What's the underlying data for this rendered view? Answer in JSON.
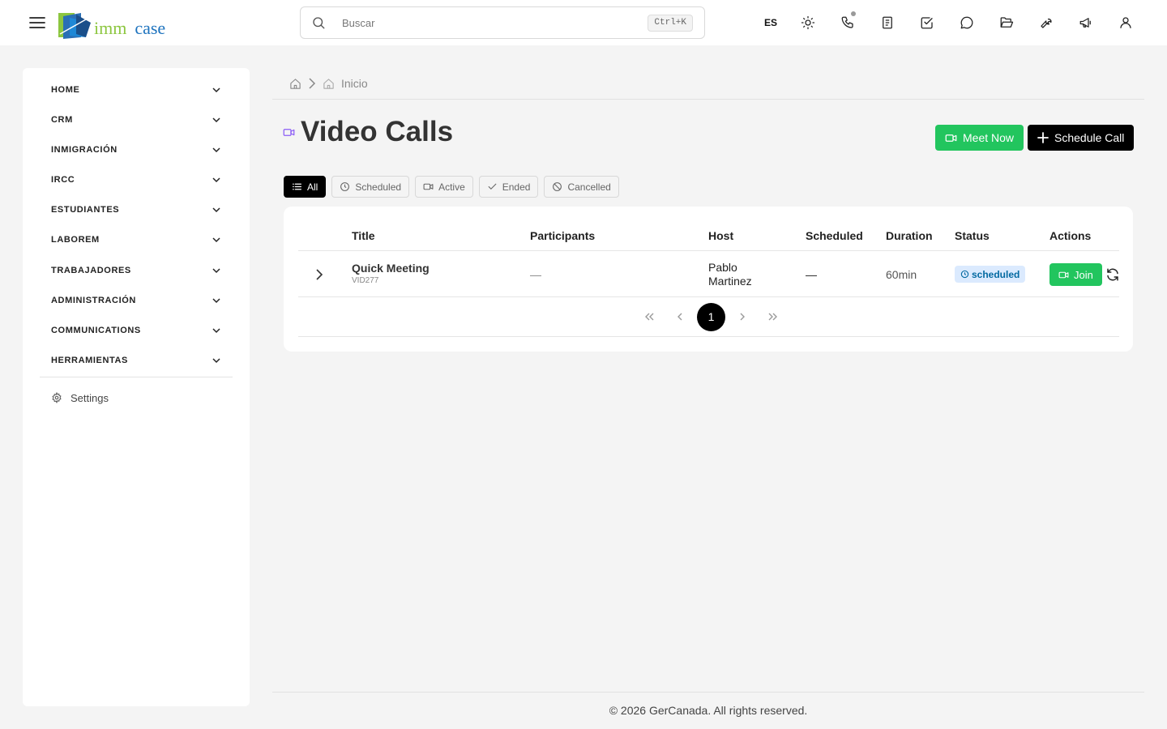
{
  "header": {
    "logo_text_a": "imm",
    "logo_text_b": "case",
    "search_placeholder": "Buscar",
    "search_shortcut": "Ctrl+K",
    "language": "ES"
  },
  "sidebar": {
    "items": [
      {
        "label": "HOME"
      },
      {
        "label": "CRM"
      },
      {
        "label": "INMIGRACIÓN"
      },
      {
        "label": "IRCC"
      },
      {
        "label": "ESTUDIANTES"
      },
      {
        "label": "LABOREM"
      },
      {
        "label": "TRABAJADORES"
      },
      {
        "label": "ADMINISTRACIÓN"
      },
      {
        "label": "COMMUNICATIONS"
      },
      {
        "label": "HERRAMIENTAS"
      }
    ],
    "settings_label": "Settings"
  },
  "breadcrumb": {
    "current": "Inicio"
  },
  "page": {
    "title": "Video Calls",
    "meet_now_label": "Meet Now",
    "schedule_call_label": "Schedule Call"
  },
  "filters": {
    "all": "All",
    "scheduled": "Scheduled",
    "active": "Active",
    "ended": "Ended",
    "cancelled": "Cancelled"
  },
  "table": {
    "columns": {
      "title": "Title",
      "participants": "Participants",
      "host": "Host",
      "scheduled": "Scheduled",
      "duration": "Duration",
      "status": "Status",
      "actions": "Actions"
    },
    "rows": [
      {
        "title": "Quick Meeting",
        "id": "VID277",
        "participants": "—",
        "host_line1": "Pablo",
        "host_line2": "Martinez",
        "scheduled": "—",
        "duration": "60min",
        "status": "scheduled",
        "join_label": "Join"
      }
    ],
    "pagination": {
      "current_page": "1"
    }
  },
  "footer": {
    "text": "© 2026 GerCanada. All rights reserved."
  },
  "colors": {
    "accent_green": "#22c55e",
    "status_badge_bg": "#dbeafe",
    "title_icon": "#8b5cf6"
  }
}
